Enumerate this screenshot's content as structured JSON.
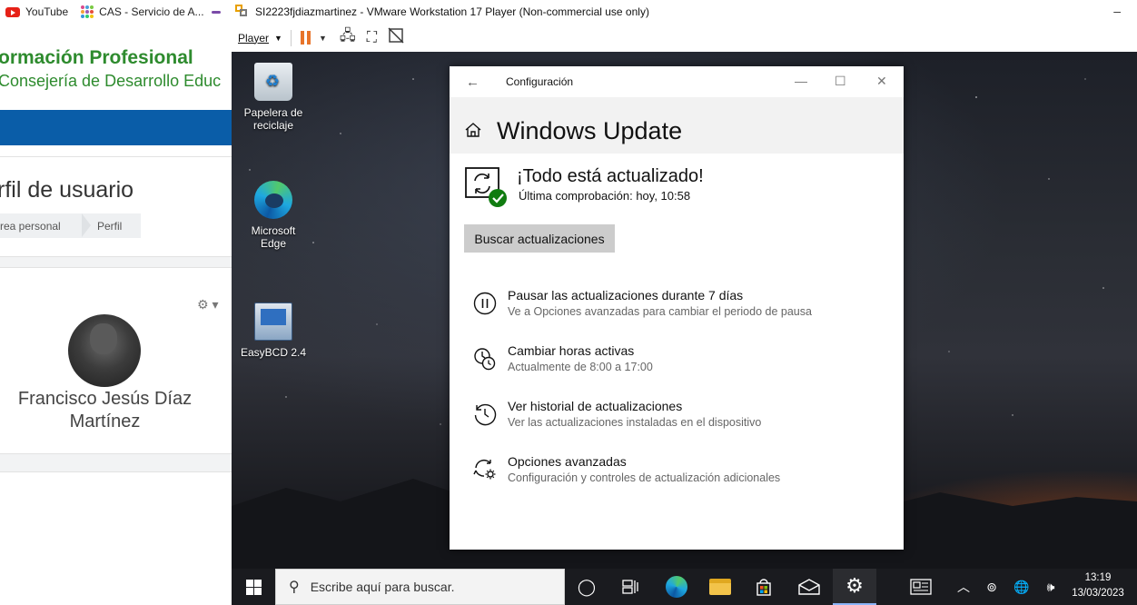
{
  "browser": {
    "bookmarks": [
      {
        "label": "YouTube",
        "icon": "youtube-icon"
      },
      {
        "label": "CAS - Servicio de A...",
        "icon": "cas-icon"
      }
    ],
    "brand_line1": "ormación Profesional",
    "brand_line2": "Consejería de Desarrollo Educ",
    "page_heading": "rfil de usuario",
    "breadcrumb": [
      "rea personal",
      "Perfil"
    ],
    "settings_menu_icon": "gear-icon",
    "user_name": "Francisco Jesús Díaz Martínez",
    "brand_color": "#2e8b2e",
    "bar_color": "#0a5da8"
  },
  "vmware": {
    "title": "SI2223fjdiazmartinez - VMware Workstation 17 Player (Non-commercial use only)",
    "minimize_glyph": "–",
    "player_menu": "Player"
  },
  "desktop": {
    "icons": [
      {
        "label": "Papelera de reciclaje",
        "icon": "recycle-bin-icon"
      },
      {
        "label": "Microsoft Edge",
        "icon": "edge-icon"
      },
      {
        "label": "EasyBCD 2.4",
        "icon": "easybcd-icon"
      }
    ]
  },
  "settings": {
    "window_title": "Configuración",
    "page_title": "Windows Update",
    "status_title": "¡Todo está actualizado!",
    "status_sub": "Última comprobación: hoy, 10:58",
    "check_button": "Buscar actualizaciones",
    "options": [
      {
        "title": "Pausar las actualizaciones durante 7 días",
        "subtitle": "Ve a Opciones avanzadas para cambiar el periodo de pausa",
        "icon": "pause-icon"
      },
      {
        "title": "Cambiar horas activas",
        "subtitle": "Actualmente de 8:00 a 17:00",
        "icon": "active-hours-icon"
      },
      {
        "title": "Ver historial de actualizaciones",
        "subtitle": "Ver las actualizaciones instaladas en el dispositivo",
        "icon": "history-icon"
      },
      {
        "title": "Opciones avanzadas",
        "subtitle": "Configuración y controles de actualización adicionales",
        "icon": "advanced-options-icon"
      }
    ],
    "accent_color": "#107c10"
  },
  "taskbar": {
    "search_placeholder": "Escribe aquí para buscar.",
    "time": "13:19",
    "date": "13/03/2023"
  }
}
